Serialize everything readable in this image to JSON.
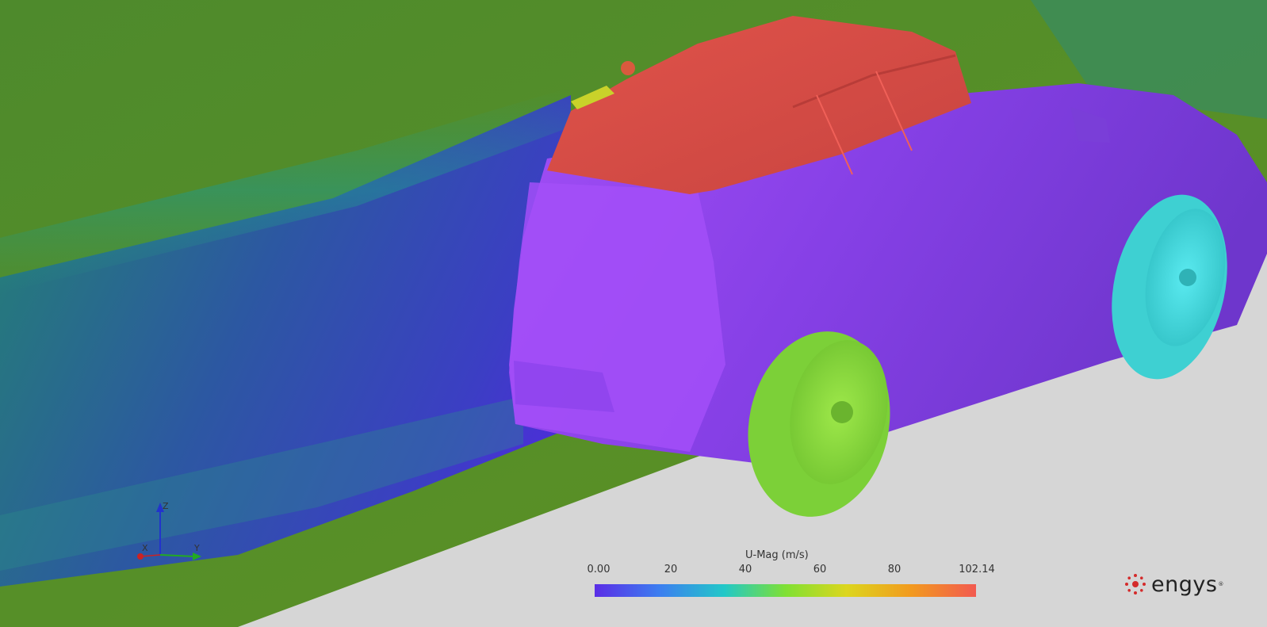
{
  "legend": {
    "title": "U-Mag (m/s)",
    "min_label": "0.00",
    "ticks": [
      "20",
      "40",
      "60",
      "80"
    ],
    "max_label": "102.14",
    "range": [
      0,
      102.14
    ]
  },
  "axes_triad": {
    "x": "X",
    "y": "Y",
    "z": "Z"
  },
  "logo": {
    "text": "engys",
    "reg": "®"
  },
  "colors": {
    "colormap": [
      "#5a2de6",
      "#3c7ef0",
      "#22c8c8",
      "#7fe034",
      "#dcd61e",
      "#f29a1f",
      "#f25a50"
    ],
    "background_flow": "#4e8a2a",
    "body": "#8a44e8",
    "roof": "#d84a44",
    "ground": "#d6d6d6"
  }
}
